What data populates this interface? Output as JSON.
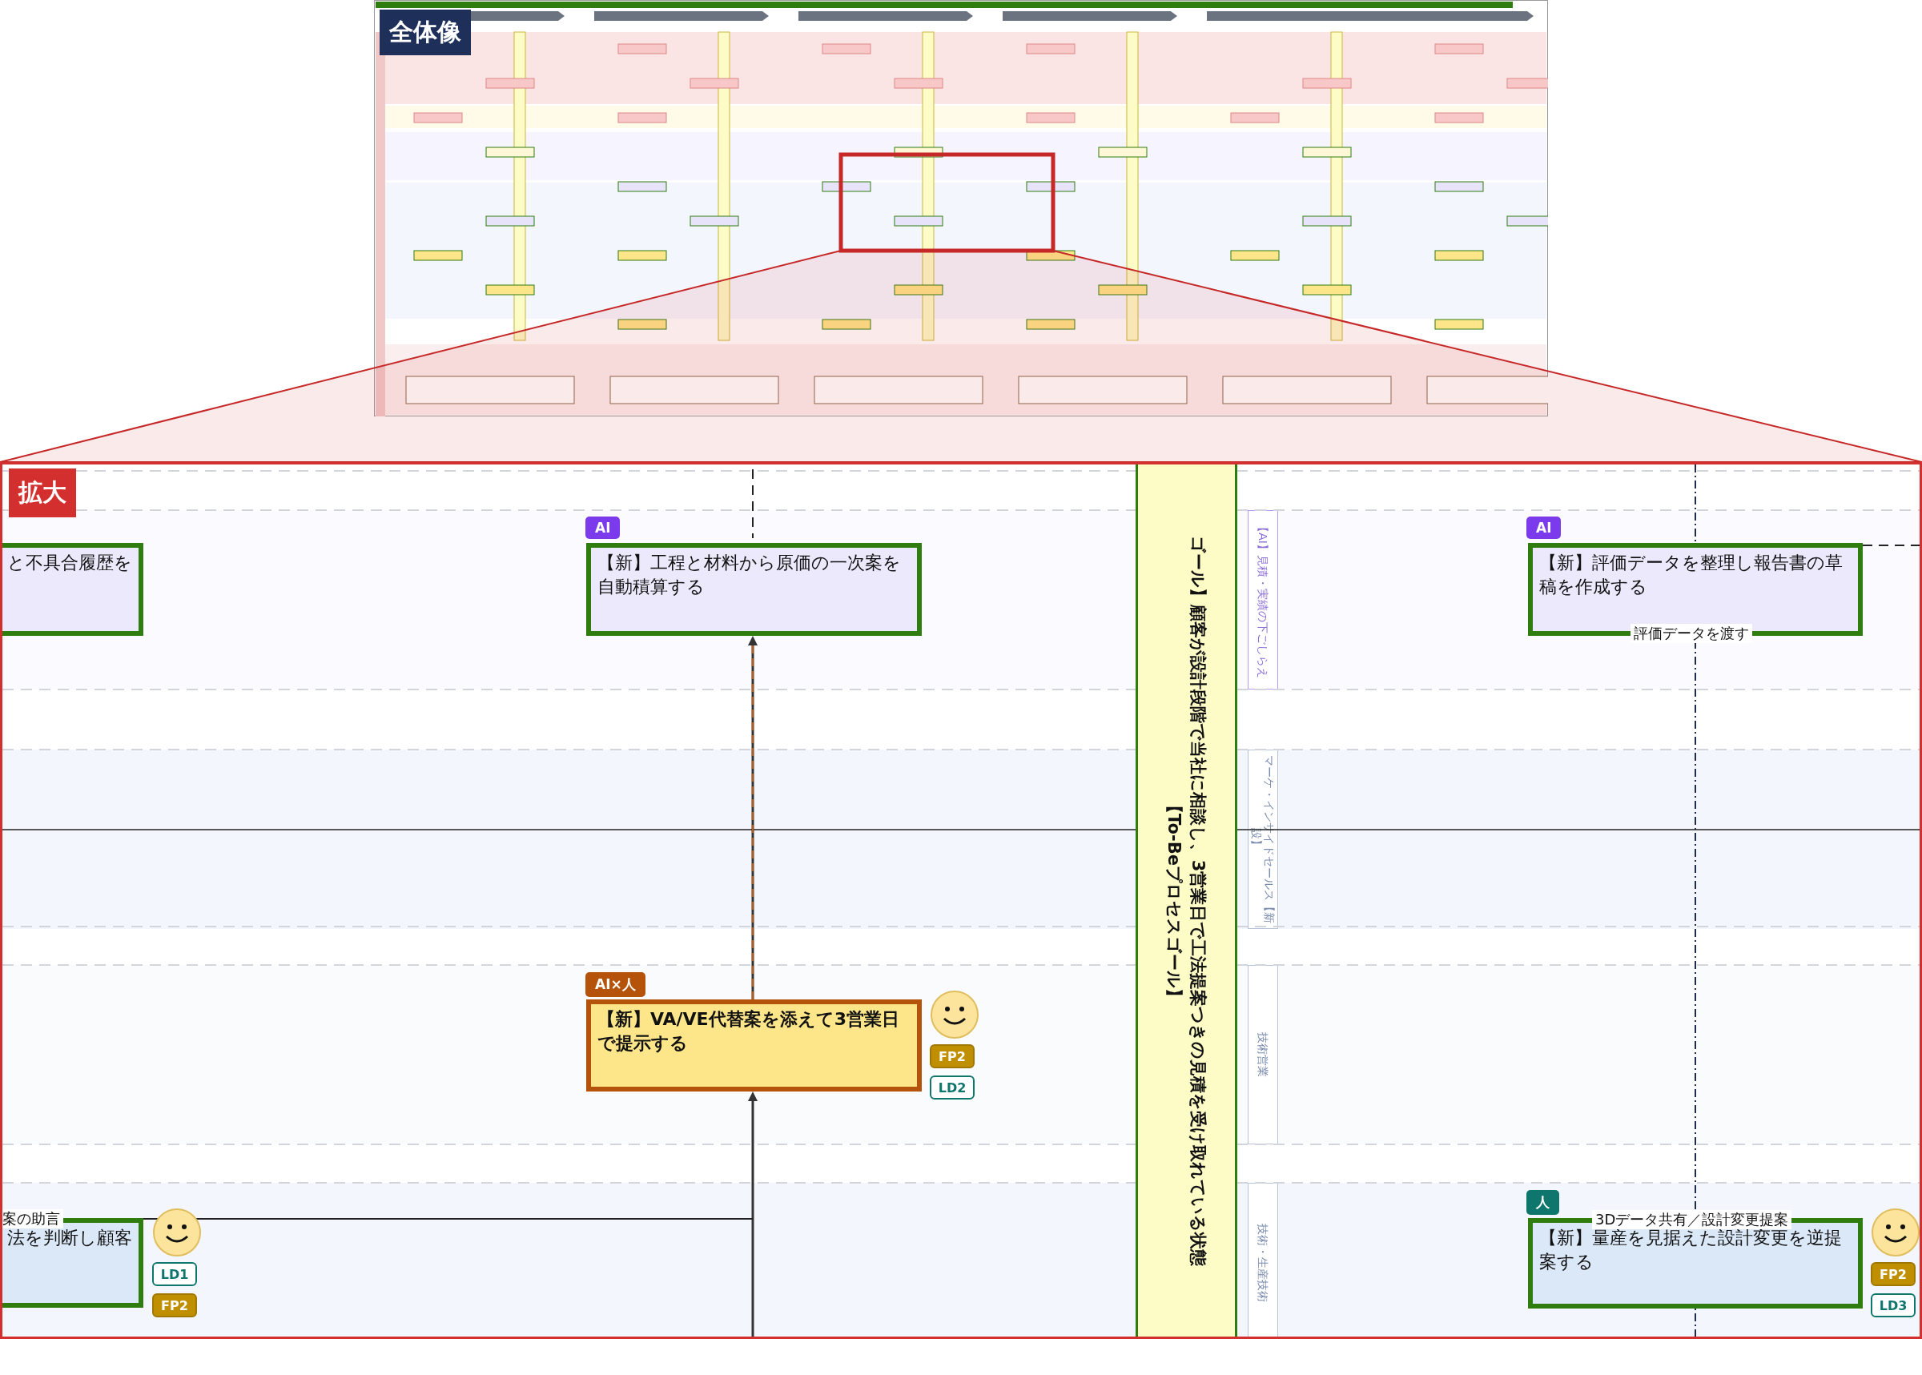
{
  "overview": {
    "label": "全体像"
  },
  "detail": {
    "label": "拡大",
    "goal": {
      "lines": [
        "ゴール】顧客が設計段階で当社に相談し、3営業日で工法提案つきの見積を受け取れている状態",
        "【To-Beプロセスゴール】"
      ]
    },
    "lanes": [
      {
        "label": "【AI】見積・実績の下ごしらえ",
        "kind": "ai"
      },
      {
        "label": "マーケ・インサイドセールス【新設】",
        "kind": "human"
      },
      {
        "label": "技術営業",
        "kind": "human"
      },
      {
        "label": "技術・生産技術",
        "kind": "human"
      }
    ],
    "nodes": [
      {
        "kind": "ai",
        "text": "と不具合履歴を"
      },
      {
        "kind": "ai",
        "badge": "AI",
        "text": "【新】工程と材料から原価の一次案を自動積算する"
      },
      {
        "kind": "ai",
        "badge": "AI",
        "text": "【新】評価データを整理し報告書の草稿を作成する"
      },
      {
        "kind": "ai_human",
        "badge": "AI×人",
        "text": "【新】VA/VE代替案を添えて3営業日で提示する",
        "avatar": true,
        "tags": [
          {
            "text": "FP2",
            "kind": "filled"
          },
          {
            "text": "LD2",
            "kind": "outline"
          }
        ]
      },
      {
        "kind": "human",
        "text": "法を判断し顧客",
        "avatar": true,
        "tags": [
          {
            "text": "LD1",
            "kind": "outline"
          },
          {
            "text": "FP2",
            "kind": "filled"
          }
        ]
      },
      {
        "kind": "human",
        "badge": "人",
        "text": "【新】量産を見据えた設計変更を逆提案する",
        "avatar": true,
        "tags": [
          {
            "text": "FP2",
            "kind": "filled"
          },
          {
            "text": "LD3",
            "kind": "outline"
          }
        ]
      }
    ],
    "edge_labels": [
      "評価データを渡す",
      "案の助言",
      "3Dデータ共有／設計変更提案"
    ]
  }
}
